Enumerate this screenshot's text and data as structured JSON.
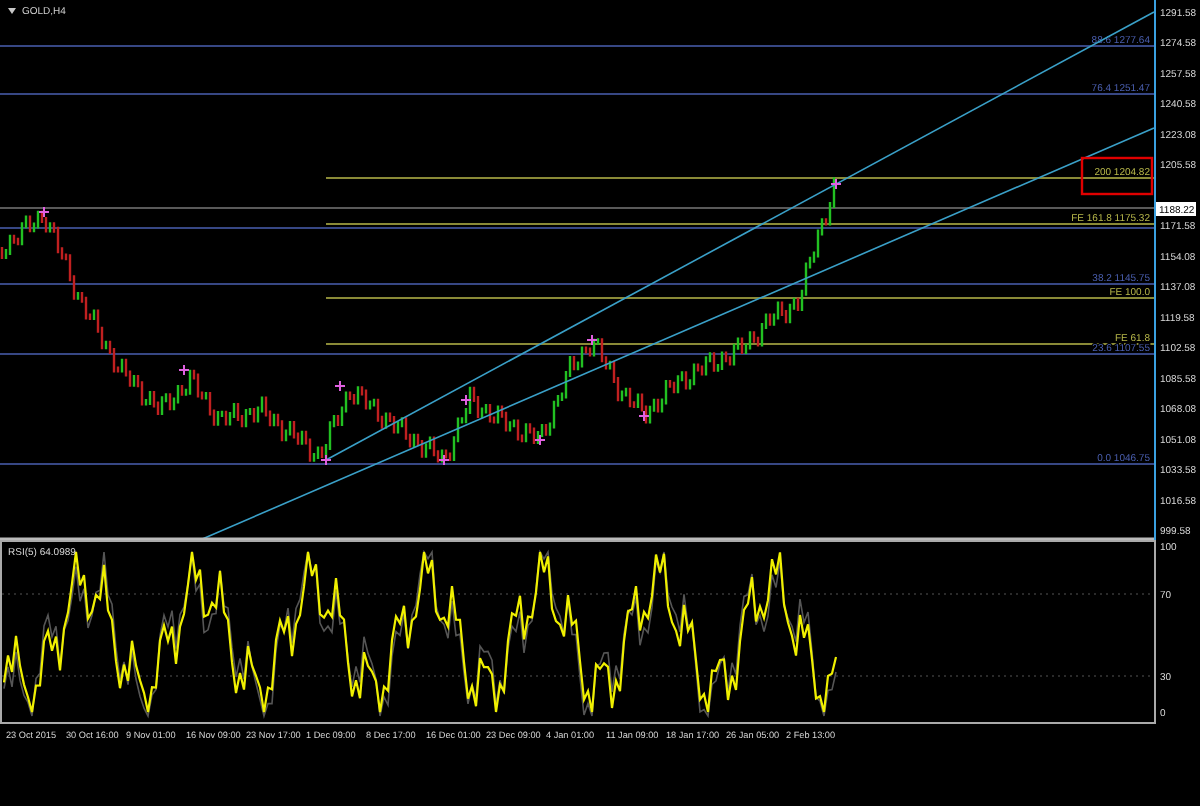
{
  "chart": {
    "title": "GOLD,H4",
    "current_price": "1188.22",
    "price_axis": [
      "1291.58",
      "1274.58",
      "1257.58",
      "1240.58",
      "1223.08",
      "1205.58",
      "1171.58",
      "1154.08",
      "1137.08",
      "1119.58",
      "1102.58",
      "1085.58",
      "1068.08",
      "1051.08",
      "1033.58",
      "1016.58",
      "999.58"
    ],
    "levels": [
      {
        "kind": "retracement",
        "label": "88.6  1277.64"
      },
      {
        "kind": "retracement",
        "label": "76.4  1251.47"
      },
      {
        "kind": "expansion",
        "label": "200  1204.82"
      },
      {
        "kind": "expansion",
        "label": "FE  161.8  1175.32"
      },
      {
        "kind": "retracement",
        "label": "38.2  1145.75"
      },
      {
        "kind": "expansion",
        "label": "FE  100.0"
      },
      {
        "kind": "expansion",
        "label": "FE  61.8"
      },
      {
        "kind": "retracement",
        "label": "23.6  1107.55"
      },
      {
        "kind": "retracement",
        "label": "0.0  1046.75"
      }
    ]
  },
  "indicator": {
    "title": "RSI(5) 64.0989",
    "axis": [
      "100",
      "70",
      "30",
      "0"
    ]
  },
  "time_axis": [
    "23 Oct 2015",
    "30 Oct 16:00",
    "9 Nov 01:00",
    "16 Nov 09:00",
    "23 Nov 17:00",
    "1 Dec 09:00",
    "8 Dec 17:00",
    "16 Dec 01:00",
    "23 Dec 09:00",
    "4 Jan 01:00",
    "11 Jan 09:00",
    "18 Jan 17:00",
    "26 Jan 05:00",
    "2 Feb 13:00"
  ]
}
